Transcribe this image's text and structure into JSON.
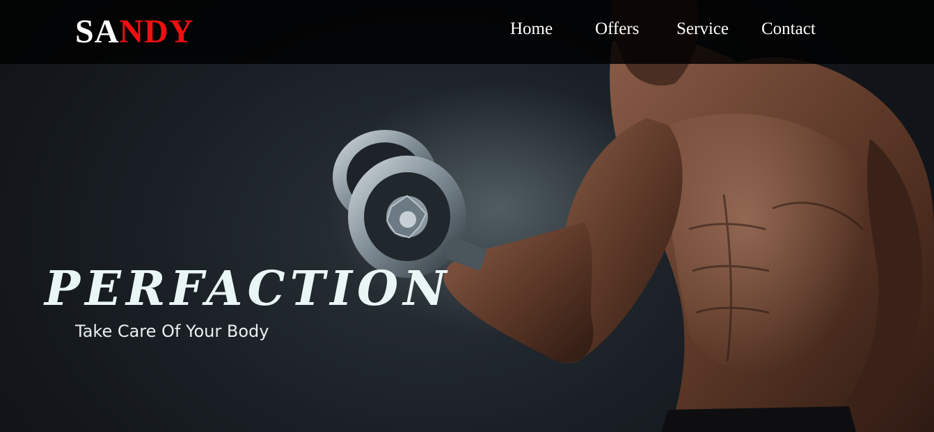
{
  "brand": {
    "logo_part1": "SA",
    "logo_part2": "NDY",
    "accent_color": "#ee1111"
  },
  "nav": {
    "items": [
      {
        "label": "Home"
      },
      {
        "label": "Offers"
      },
      {
        "label": "Service"
      },
      {
        "label": "Contact"
      }
    ]
  },
  "hero": {
    "headline": "PERFACTION",
    "tagline": "Take Care Of Your Body",
    "image_subject": "bodybuilder-lifting-dumbbell"
  }
}
